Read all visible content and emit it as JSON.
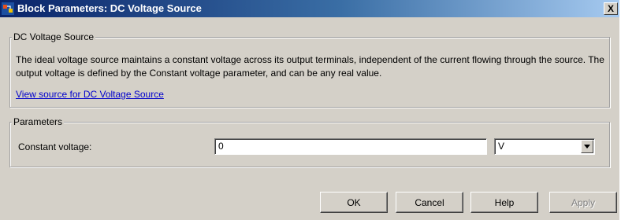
{
  "window": {
    "title": "Block Parameters: DC Voltage Source",
    "close_glyph": "X",
    "title_icon": "simulink-block-icon",
    "titlebar_color": "#0a246a"
  },
  "description_group": {
    "legend": "DC Voltage Source",
    "text": "The ideal voltage source maintains a constant voltage across its output terminals, independent of the current flowing through the source. The output voltage is defined by the Constant voltage parameter, and can be any real value.",
    "link_text": "View source for DC Voltage Source"
  },
  "parameters_group": {
    "legend": "Parameters",
    "constant_voltage_label": "Constant voltage:",
    "constant_voltage_value": "0",
    "unit_selected": "V"
  },
  "buttons": {
    "ok": "OK",
    "cancel": "Cancel",
    "help": "Help",
    "apply": "Apply"
  }
}
